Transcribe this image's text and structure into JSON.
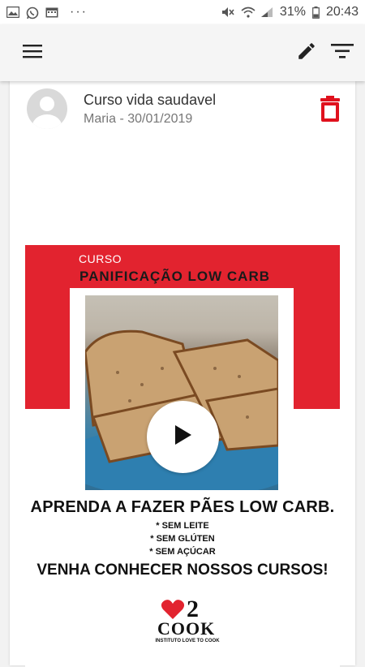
{
  "status_bar": {
    "icons_left": [
      "image-icon",
      "whatsapp-icon",
      "calendar-icon",
      "more-icon"
    ],
    "more": "···",
    "battery": "31%",
    "time": "20:43"
  },
  "toolbar": {
    "menu_icon": "menu-icon",
    "edit_icon": "pencil-icon",
    "filter_icon": "filter-icon"
  },
  "post": {
    "title": "Curso vida saudavel",
    "meta": "Maria - 30/01/2019",
    "delete_icon": "trash-icon"
  },
  "flyer": {
    "label": "CURSO",
    "course_name": "PANIFICAÇÃO LOW CARB",
    "headline": "APRENDA A FAZER PÃES LOW CARB.",
    "bullets": [
      "* SEM LEITE",
      "* SEM GLÚTEN",
      "* SEM AÇÚCAR"
    ],
    "cta": "VENHA CONHECER NOSSOS CURSOS!",
    "logo_number": "2",
    "logo_word": "COOK",
    "logo_tagline": "INSTITUTO LOVE TO COOK"
  },
  "colors": {
    "accent_red": "#e2232f",
    "trash_red": "#e0111d",
    "toolbar_bg": "#f5f5f5"
  }
}
